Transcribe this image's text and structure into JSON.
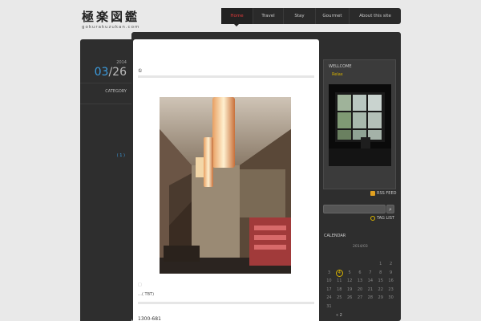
{
  "site": {
    "title": "極楽図鑑",
    "subtitle": "gokurakuzukan.com"
  },
  "nav": {
    "items": [
      "Home",
      "Travel",
      "Stay",
      "Gourmet",
      "About this site"
    ],
    "active_index": 0
  },
  "post": {
    "year": "2014",
    "month": "03",
    "day": "/26",
    "category_label": "CATEGORY",
    "category_link": "( 1 )",
    "heading": "①",
    "caption_marker": "□",
    "caption": "…( TBT)",
    "tel": "1300-681"
  },
  "sidebar": {
    "welcome_title": "WELLCOME",
    "welcome_sub": "Relax",
    "rss_label": "RSS FEED",
    "taglist_label": "TAG LIST",
    "search_button": "⌕",
    "calendar_title": "CALENDAR",
    "calendar_month": "2014/03",
    "calendar_today": "4",
    "calendar_rows": [
      [
        "",
        "",
        "",
        "",
        "",
        "1",
        "2"
      ],
      [
        "3",
        "4",
        "5",
        "6",
        "7",
        "8",
        "9"
      ],
      [
        "10",
        "11",
        "12",
        "13",
        "14",
        "15",
        "16"
      ],
      [
        "17",
        "18",
        "19",
        "20",
        "21",
        "22",
        "23"
      ],
      [
        "24",
        "25",
        "26",
        "27",
        "28",
        "29",
        "30"
      ],
      [
        "31",
        "",
        "",
        "",
        "",
        "",
        ""
      ]
    ],
    "calendar_prev": "« 2"
  },
  "colors": {
    "accent_blue": "#3c9de0",
    "accent_red": "#e03a3a",
    "accent_gold": "#d8b300"
  }
}
